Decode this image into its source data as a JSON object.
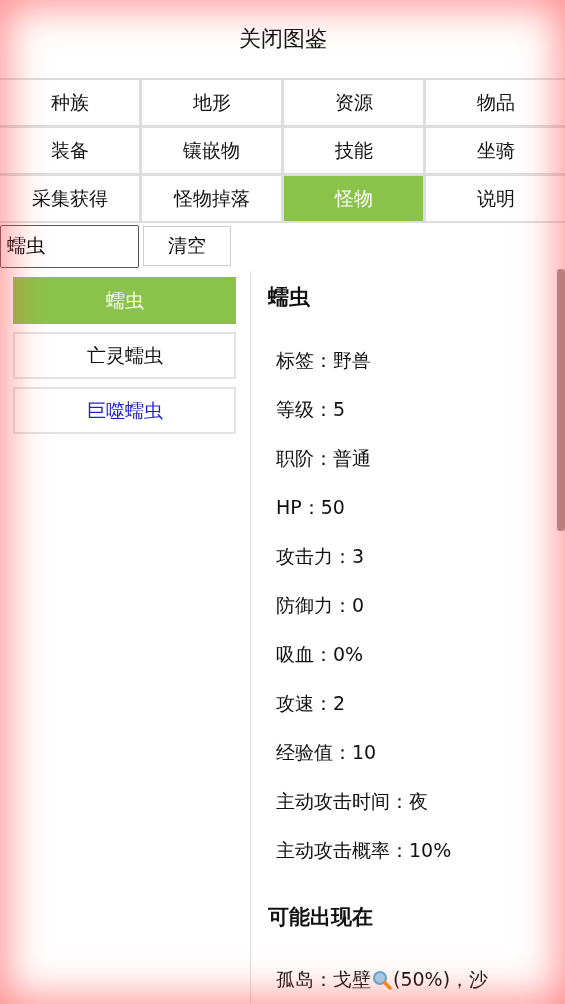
{
  "header": {
    "title": "关闭图鉴"
  },
  "tabs": [
    {
      "label": "种族",
      "selected": false
    },
    {
      "label": "地形",
      "selected": false
    },
    {
      "label": "资源",
      "selected": false
    },
    {
      "label": "物品",
      "selected": false
    },
    {
      "label": "装备",
      "selected": false
    },
    {
      "label": "镶嵌物",
      "selected": false
    },
    {
      "label": "技能",
      "selected": false
    },
    {
      "label": "坐骑",
      "selected": false
    },
    {
      "label": "采集获得",
      "selected": false
    },
    {
      "label": "怪物掉落",
      "selected": false
    },
    {
      "label": "怪物",
      "selected": true
    },
    {
      "label": "说明",
      "selected": false
    }
  ],
  "search": {
    "value": "蠕虫",
    "clear_button": "清空"
  },
  "results": [
    {
      "label": "蠕虫",
      "selected": true,
      "highlighted": false
    },
    {
      "label": "亡灵蠕虫",
      "selected": false,
      "highlighted": false
    },
    {
      "label": "巨噬蠕虫",
      "selected": false,
      "highlighted": true
    }
  ],
  "detail": {
    "title": "蠕虫",
    "fields": [
      "标签：野兽",
      "等级：5",
      "职阶：普通",
      "HP：50",
      "攻击力：3",
      "防御力：0",
      "吸血：0%",
      "攻速：2",
      "经验值：10",
      "主动攻击时间：夜",
      "主动攻击概率：10%"
    ],
    "section_title": "可能出现在",
    "spawns": [
      {
        "before": "孤岛：戈壁",
        "after": "(50%)，沙"
      }
    ]
  }
}
